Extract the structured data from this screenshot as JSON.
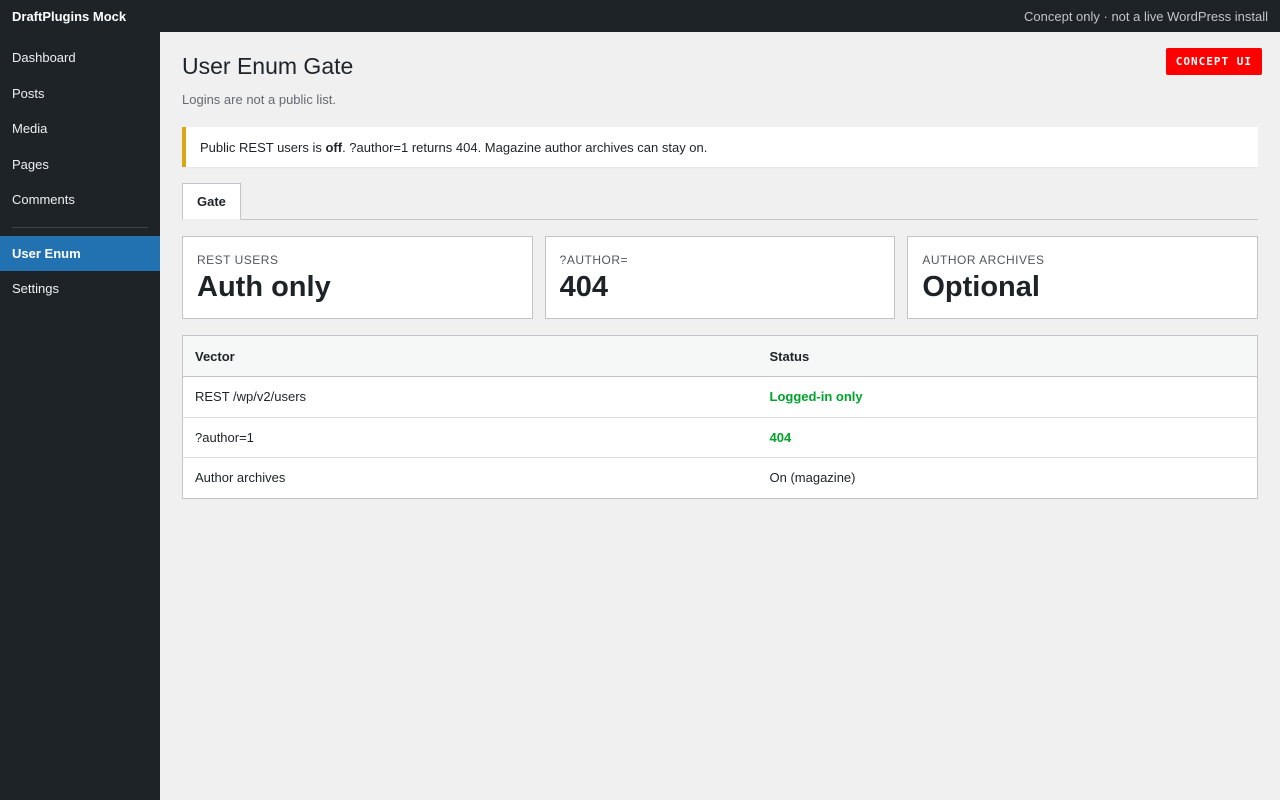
{
  "topbar": {
    "brand": "DraftPlugins Mock",
    "note": "Concept only · not a live WordPress install"
  },
  "sidebar": {
    "items": [
      {
        "label": "Dashboard"
      },
      {
        "label": "Posts"
      },
      {
        "label": "Media"
      },
      {
        "label": "Pages"
      },
      {
        "label": "Comments"
      }
    ],
    "plugin_items": [
      {
        "label": "User Enum",
        "active": true
      },
      {
        "label": "Settings"
      }
    ]
  },
  "page": {
    "title": "User Enum Gate",
    "subtitle": "Logins are not a public list.",
    "badge": "CONCEPT UI"
  },
  "notice": {
    "prefix": "Public REST users is ",
    "emphasis": "off",
    "suffix": ". ?author=1 returns 404. Magazine author archives can stay on."
  },
  "tabs": [
    {
      "label": "Gate",
      "active": true
    }
  ],
  "cards": [
    {
      "label": "REST users",
      "value": "Auth only"
    },
    {
      "label": "?author=",
      "value": "404"
    },
    {
      "label": "Author archives",
      "value": "Optional"
    }
  ],
  "table": {
    "headers": [
      "Vector",
      "Status"
    ],
    "rows": [
      {
        "vector": "REST /wp/v2/users",
        "status": "Logged-in only",
        "status_style": "good"
      },
      {
        "vector": "?author=1",
        "status": "404",
        "status_style": "good"
      },
      {
        "vector": "Author archives",
        "status": "On (magazine)",
        "status_style": "normal"
      }
    ]
  },
  "colors": {
    "admin_bar": "#1d2327",
    "accent": "#2271b1",
    "notice_border": "#dba617",
    "badge": "#ff0000",
    "success": "#00a32a"
  }
}
